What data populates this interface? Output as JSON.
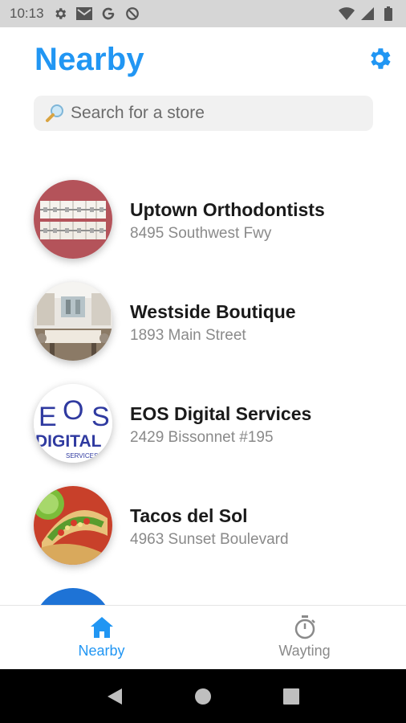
{
  "status_bar": {
    "time": "10:13",
    "icons_left": [
      "settings-icon",
      "mail-icon",
      "google-icon",
      "sync-icon"
    ],
    "icons_right": [
      "wifi-icon",
      "signal-icon",
      "battery-icon"
    ]
  },
  "header": {
    "title": "Nearby",
    "settings_icon": "gear-icon",
    "accent_color": "#2196f3"
  },
  "search": {
    "placeholder": "Search for a store",
    "value": ""
  },
  "stores": [
    {
      "name": "Uptown Orthodontists",
      "address": "8495 Southwest Fwy",
      "image": "braces-photo"
    },
    {
      "name": "Westside Boutique",
      "address": "1893 Main Street",
      "image": "boutique-interior-photo"
    },
    {
      "name": "EOS Digital Services",
      "address": "2429 Bissonnet #195",
      "image": "eos-logo"
    },
    {
      "name": "Tacos del Sol",
      "address": "4963 Sunset Boulevard",
      "image": "tacos-photo"
    }
  ],
  "logo_text": "EOS DIGITAL SERVICES",
  "bottom_nav": {
    "items": [
      {
        "label": "Nearby",
        "icon": "home-icon",
        "active": true
      },
      {
        "label": "Wayting",
        "icon": "stopwatch-icon",
        "active": false
      }
    ]
  },
  "system_nav": {
    "buttons": [
      "back-icon",
      "home-circle-icon",
      "recents-icon"
    ]
  }
}
